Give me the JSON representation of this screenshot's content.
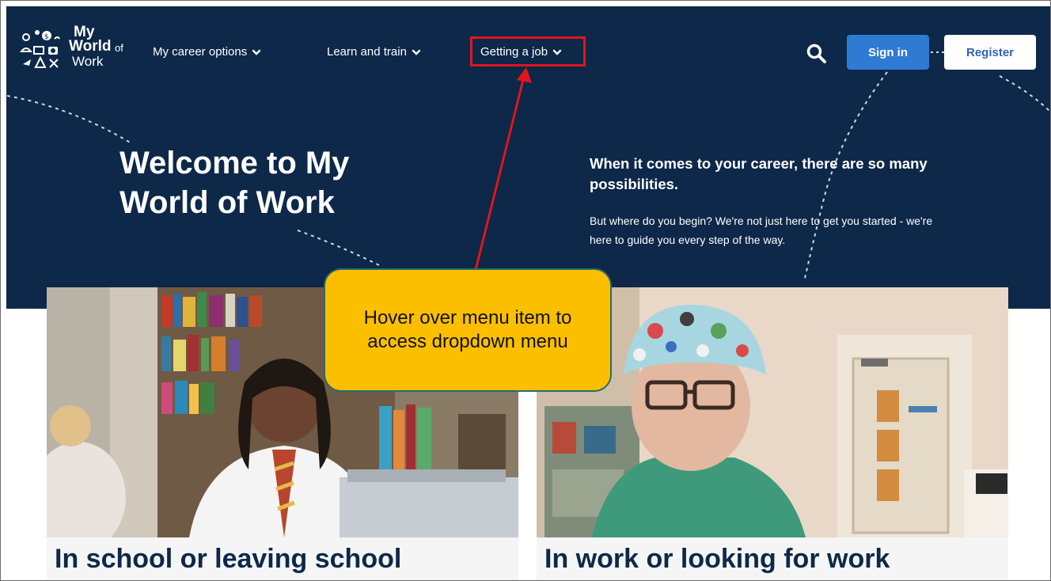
{
  "logo": {
    "line_my": "My",
    "line_world": "World",
    "line_of": "of",
    "line_work": "Work"
  },
  "nav": {
    "items": [
      {
        "label": "My career options"
      },
      {
        "label": "Learn and train"
      },
      {
        "label": "Getting a job"
      }
    ]
  },
  "header": {
    "signin_label": "Sign in",
    "register_label": "Register"
  },
  "hero": {
    "title": "Welcome to My World of Work",
    "lead": "When it comes to your career, there are so many possibilities.",
    "body": "But where do you begin? We're not just here to get you started - we're here to guide you every step of the way."
  },
  "cards": [
    {
      "title": "In school or leaving school"
    },
    {
      "title": "In work or looking for work"
    }
  ],
  "annotation": {
    "text": "Hover over menu item to access dropdown menu"
  },
  "colors": {
    "hero_bg": "#0d2849",
    "signin_bg": "#2f7ad3",
    "register_text": "#2f63b8",
    "highlight": "#e0161d",
    "callout_bg": "#fcbf00"
  },
  "icons": {
    "search": "search-icon",
    "chevron": "chevron-down-icon",
    "arrow": "arrow-icon"
  }
}
